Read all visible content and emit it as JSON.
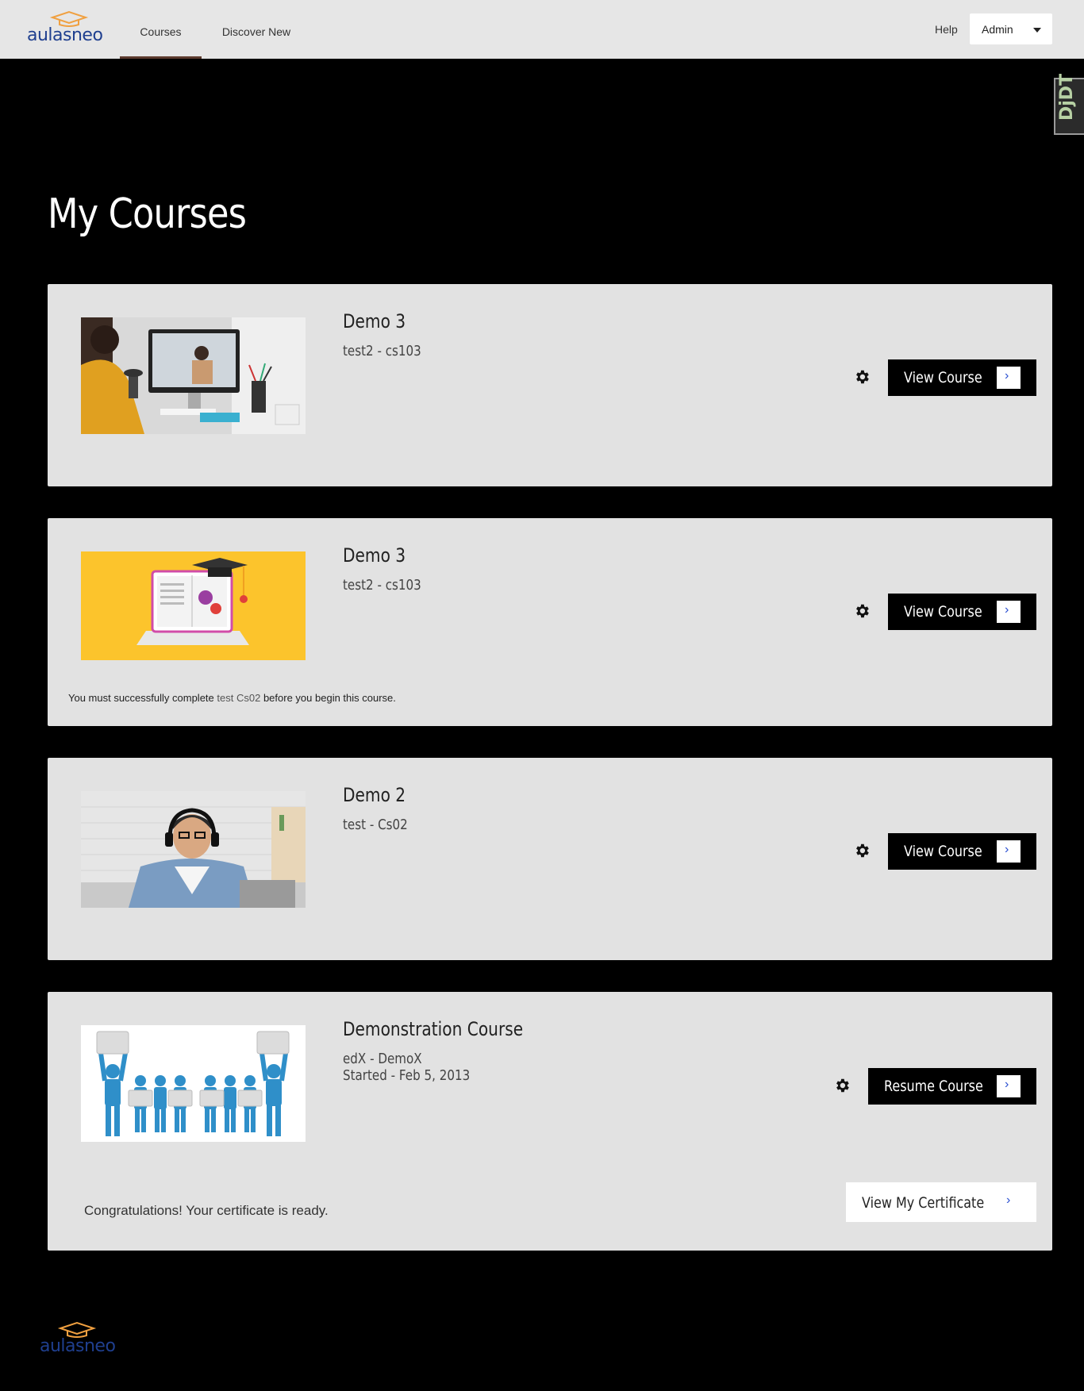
{
  "brand": {
    "name": "aulasneo",
    "logo_color": "#1f3f8f",
    "cap_color": "#f0a040"
  },
  "nav": {
    "tabs": [
      {
        "label": "Courses",
        "active": true
      },
      {
        "label": "Discover New",
        "active": false
      }
    ],
    "help": "Help",
    "user": "Admin"
  },
  "debug_toolbar": {
    "label": "DjDT"
  },
  "page": {
    "title": "My Courses"
  },
  "courses": [
    {
      "name": "Demo 3",
      "code": "test2 - cs103",
      "button": "View Course",
      "thumbnail": "woman-video-call-image"
    },
    {
      "name": "Demo 3",
      "code": "test2 - cs103",
      "button": "View Course",
      "thumbnail": "laptop-book-graduation-cap-illustration",
      "prereq": {
        "before": "You must successfully complete",
        "link": "test Cs02",
        "after": "before you begin this course."
      }
    },
    {
      "name": "Demo 2",
      "code": "test - Cs02",
      "button": "View Course",
      "thumbnail": "man-with-headphones-image"
    },
    {
      "name": "Demonstration Course",
      "code": "edX - DemoX",
      "started": "Started - Feb 5, 2013",
      "button": "Resume Course",
      "thumbnail": "puzzle-people-teamwork-image",
      "certificate": {
        "message": "Congratulations! Your certificate is ready.",
        "button": "View My Certificate"
      }
    }
  ],
  "icons": {
    "settings": "gear-icon",
    "arrow": "chevron-right-icon",
    "dropdown": "caret-down-icon"
  },
  "colors": {
    "header_bg": "#e6e6e6",
    "page_bg": "#000000",
    "card_bg": "#e2e2e2",
    "button_bg": "#000000",
    "accent": "#2a4fd1"
  }
}
